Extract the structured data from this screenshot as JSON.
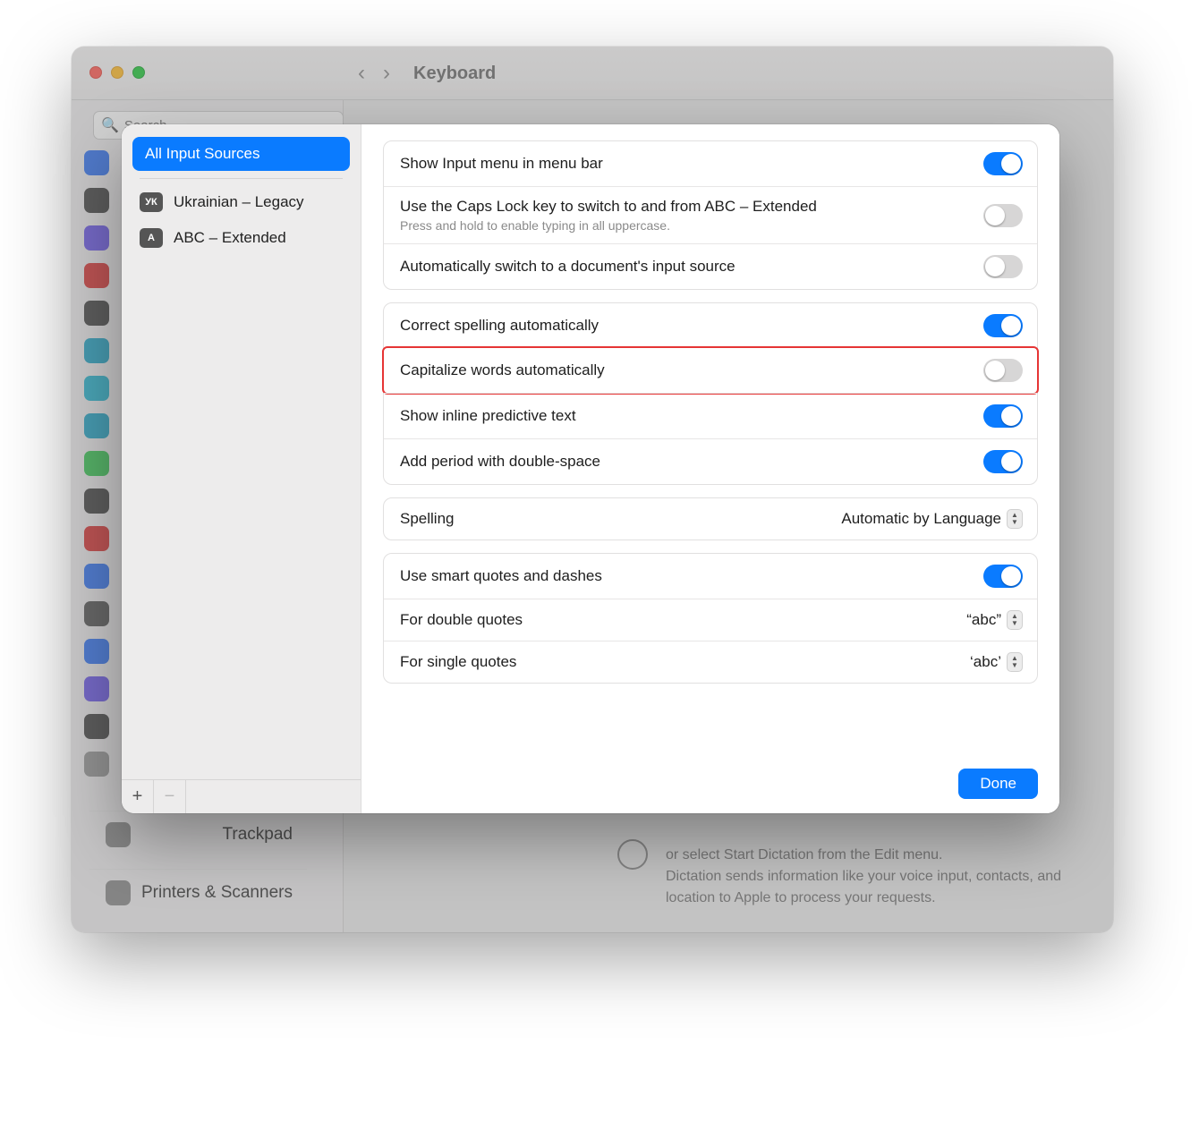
{
  "window": {
    "title": "Keyboard",
    "traffic_light_colors": [
      "#ff5f57",
      "#febc2e",
      "#28c840"
    ]
  },
  "background_sidebar": {
    "search_placeholder": "Search",
    "bottom_items": [
      {
        "label": "Trackpad"
      },
      {
        "label": "Printers & Scanners"
      }
    ]
  },
  "background_dictation": {
    "line1": "or select Start Dictation from the Edit menu.",
    "line2": "Dictation sends information like your voice input, contacts, and location to Apple to process your requests."
  },
  "sheet": {
    "sources_header": "All Input Sources",
    "sources": [
      {
        "flag_text": "УК",
        "label": "Ukrainian – Legacy"
      },
      {
        "flag_text": "A",
        "label": "ABC – Extended"
      }
    ],
    "add_label": "+",
    "remove_label": "−",
    "groups": [
      {
        "rows": [
          {
            "title": "Show Input menu in menu bar",
            "toggle": true
          },
          {
            "title": "Use the Caps Lock key to switch to and from ABC – Extended",
            "sub": "Press and hold to enable typing in all uppercase.",
            "toggle": false
          },
          {
            "title": "Automatically switch to a document's input source",
            "toggle": false
          }
        ]
      },
      {
        "rows": [
          {
            "title": "Correct spelling automatically",
            "toggle": true
          },
          {
            "title": "Capitalize words automatically",
            "toggle": false,
            "highlight": true
          },
          {
            "title": "Show inline predictive text",
            "toggle": true
          },
          {
            "title": "Add period with double-space",
            "toggle": true
          }
        ]
      },
      {
        "rows": [
          {
            "title": "Spelling",
            "select_value": "Automatic by Language"
          }
        ]
      },
      {
        "rows": [
          {
            "title": "Use smart quotes and dashes",
            "toggle": true
          },
          {
            "title": "For double quotes",
            "select_value": "“abc”"
          },
          {
            "title": "For single quotes",
            "select_value": "‘abc’"
          }
        ]
      }
    ],
    "done_label": "Done"
  }
}
